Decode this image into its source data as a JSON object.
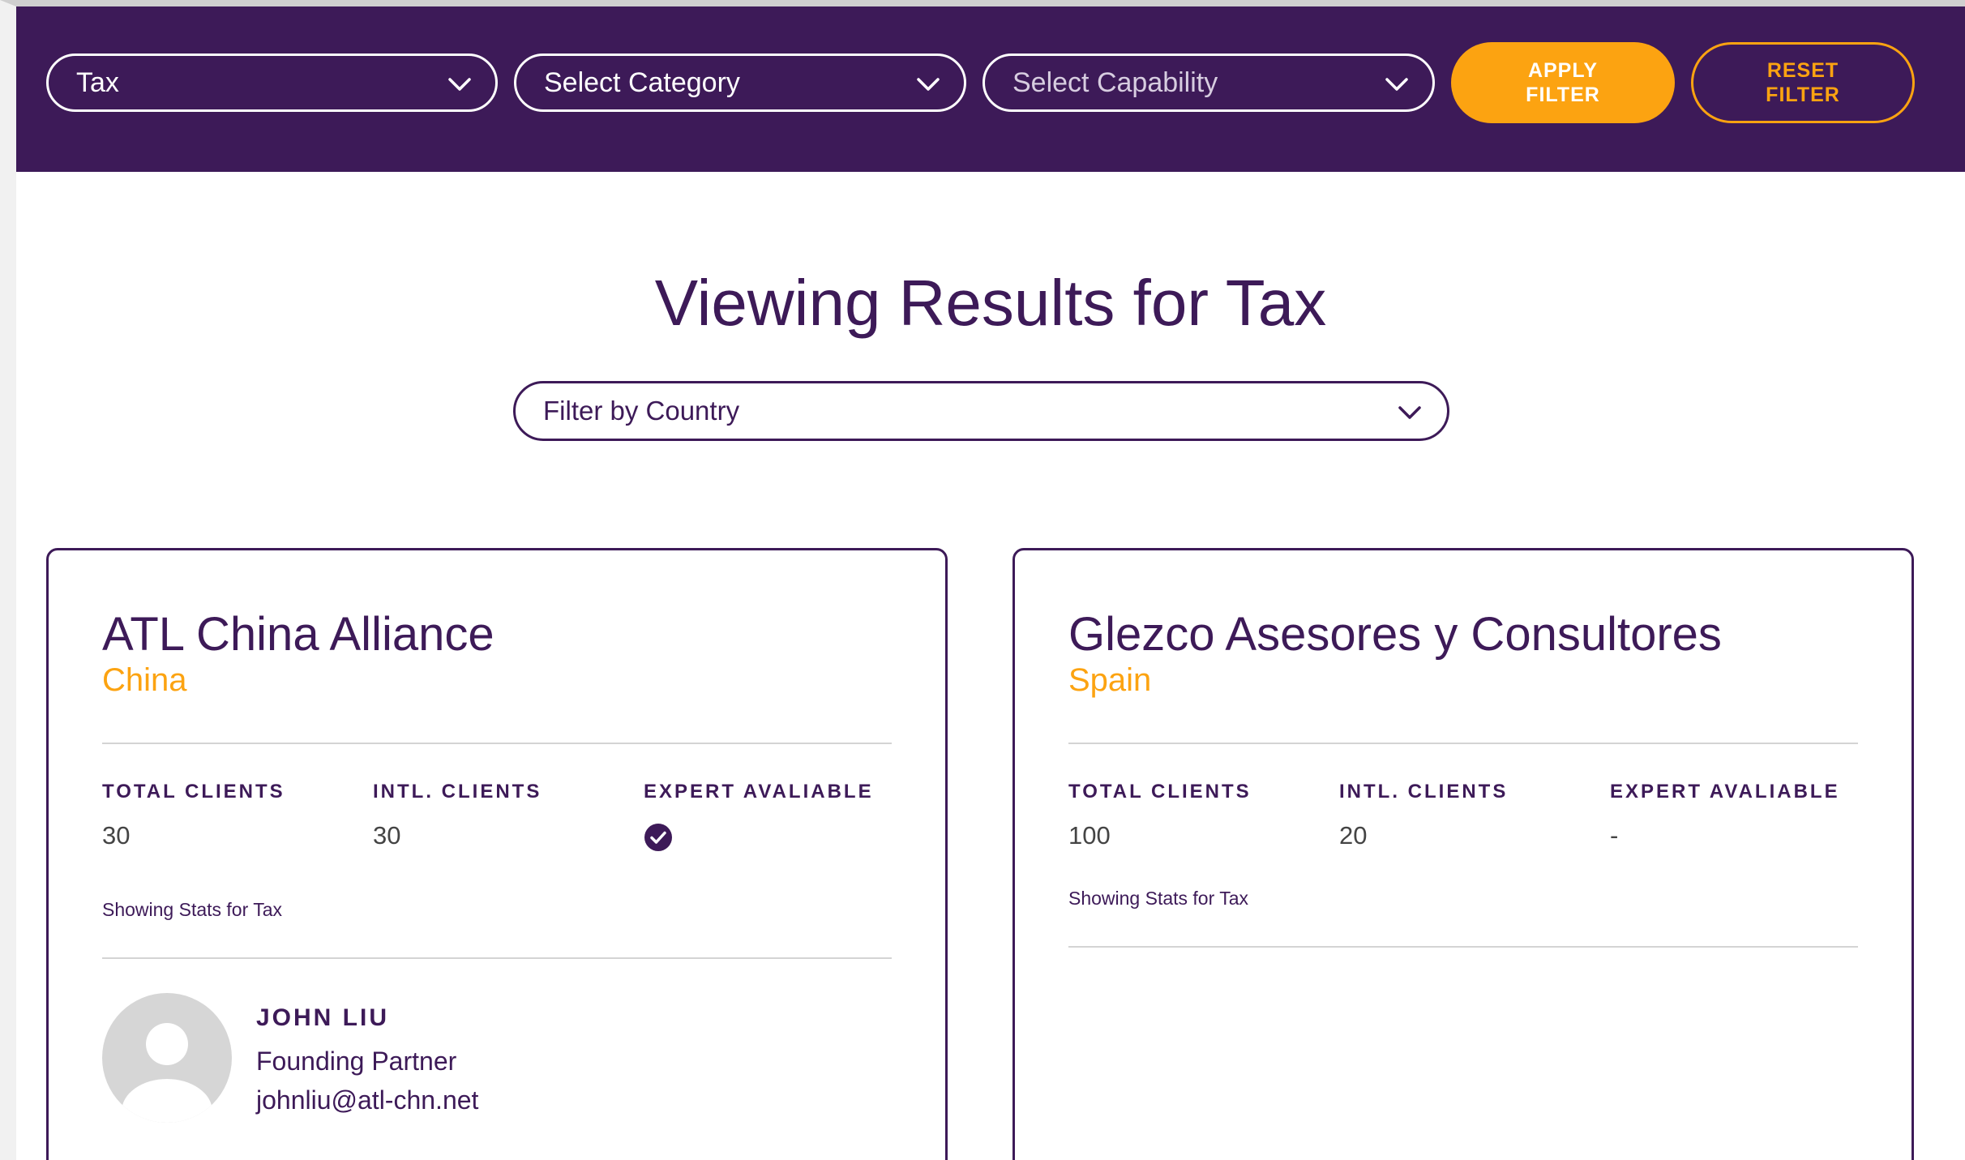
{
  "filters": {
    "service": "Tax",
    "category_placeholder": "Select Category",
    "capability_placeholder": "Select Capability",
    "apply_label": "APPLY\nFILTER",
    "reset_label": "RESET\nFILTER"
  },
  "results": {
    "heading": "Viewing Results for Tax",
    "country_filter_placeholder": "Filter by Country"
  },
  "colors": {
    "primary": "#3d1a58",
    "accent": "#fca311"
  },
  "cards": [
    {
      "name": "ATL China Alliance",
      "country": "China",
      "stats": [
        {
          "label": "TOTAL CLIENTS",
          "value": "30"
        },
        {
          "label": "INTL. CLIENTS",
          "value": "30"
        },
        {
          "label": "EXPERT AVALIABLE",
          "value": "check-circle-icon"
        }
      ],
      "stats_note": "Showing Stats for Tax",
      "contact": {
        "avatar": "user-avatar-placeholder-icon",
        "name": "JOHN LIU",
        "title": "Founding Partner",
        "email": "johnliu@atl-chn.net"
      }
    },
    {
      "name": "Glezco Asesores y Consultores",
      "country": "Spain",
      "stats": [
        {
          "label": "TOTAL CLIENTS",
          "value": "100"
        },
        {
          "label": "INTL. CLIENTS",
          "value": "20"
        },
        {
          "label": "EXPERT AVALIABLE",
          "value": "-"
        }
      ],
      "stats_note": "Showing Stats for Tax"
    }
  ]
}
